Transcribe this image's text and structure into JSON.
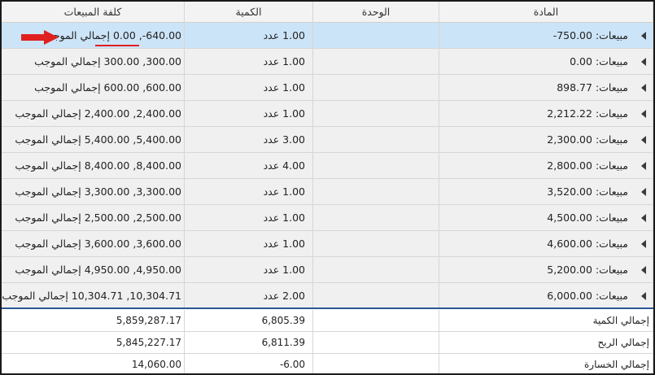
{
  "columns": {
    "item": "المادة",
    "unit": "الوحدة",
    "qty": "الكمية",
    "cost": "كلفة المبيعات"
  },
  "rows": [
    {
      "item": "مبيعات: 750.00-",
      "unit": "",
      "qty": "1.00 عدد",
      "cost": "640.00-, 0.00 إجمالي الموجب"
    },
    {
      "item": "مبيعات: 0.00",
      "unit": "",
      "qty": "1.00 عدد",
      "cost": "300.00, 300.00 إجمالي الموجب"
    },
    {
      "item": "مبيعات: 898.77",
      "unit": "",
      "qty": "1.00 عدد",
      "cost": "600.00, 600.00 إجمالي الموجب"
    },
    {
      "item": "مبيعات: 2,212.22",
      "unit": "",
      "qty": "1.00 عدد",
      "cost": "2,400.00, 2,400.00 إجمالي الموجب"
    },
    {
      "item": "مبيعات: 2,300.00",
      "unit": "",
      "qty": "3.00 عدد",
      "cost": "5,400.00, 5,400.00 إجمالي الموجب"
    },
    {
      "item": "مبيعات: 2,800.00",
      "unit": "",
      "qty": "4.00 عدد",
      "cost": "8,400.00, 8,400.00 إجمالي الموجب"
    },
    {
      "item": "مبيعات: 3,520.00",
      "unit": "",
      "qty": "1.00 عدد",
      "cost": "3,300.00, 3,300.00 إجمالي الموجب"
    },
    {
      "item": "مبيعات: 4,500.00",
      "unit": "",
      "qty": "1.00 عدد",
      "cost": "2,500.00, 2,500.00 إجمالي الموجب"
    },
    {
      "item": "مبيعات: 4,600.00",
      "unit": "",
      "qty": "1.00 عدد",
      "cost": "3,600.00, 3,600.00 إجمالي الموجب"
    },
    {
      "item": "مبيعات: 5,200.00",
      "unit": "",
      "qty": "1.00 عدد",
      "cost": "4,950.00, 4,950.00 إجمالي الموجب"
    },
    {
      "item": "مبيعات: 6,000.00",
      "unit": "",
      "qty": "2.00 عدد",
      "cost": "10,304.71, 10,304.71 إجمالي الموجب"
    }
  ],
  "totals": [
    {
      "label": "إجمالي الكمية",
      "unit": "",
      "qty": "6,805.39",
      "cost": "5,859,287.17"
    },
    {
      "label": "إجمالي الربح",
      "unit": "",
      "qty": "6,811.39",
      "cost": "5,845,227.17"
    },
    {
      "label": "إجمالي الخسارة",
      "unit": "",
      "qty": "-6.00",
      "cost": "14,060.00"
    }
  ],
  "colors": {
    "selected_row": "#cce4f7",
    "row_bg": "#f0f0f0",
    "annotation": "#e02020",
    "separator": "#2b5797"
  },
  "icons": {
    "expander": "triangle-left-icon",
    "annotation_arrow": "red-arrow-icon"
  }
}
